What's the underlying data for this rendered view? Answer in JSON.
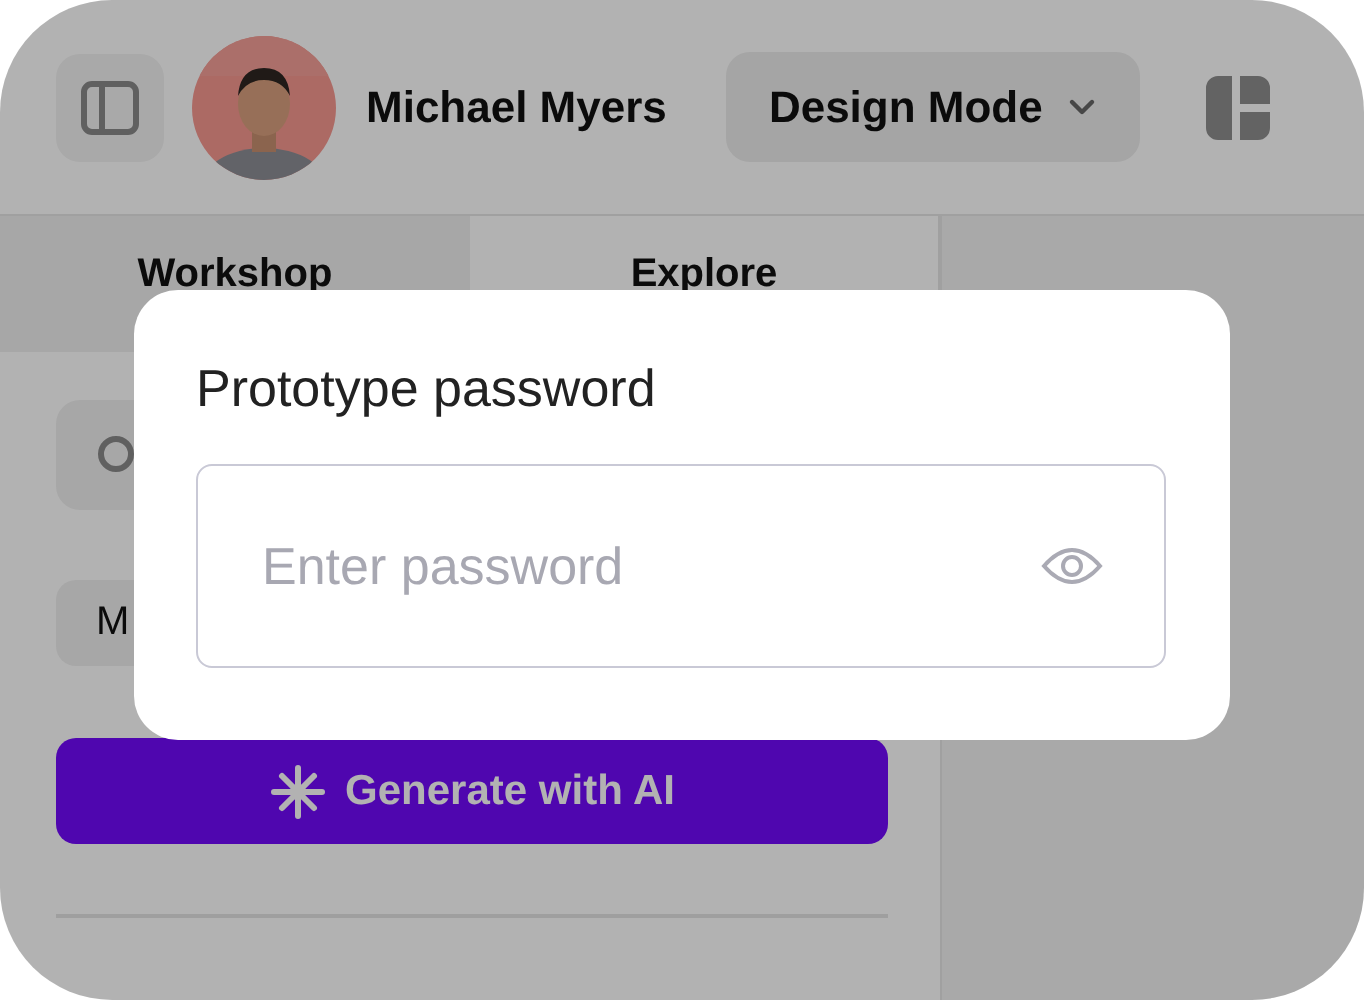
{
  "header": {
    "user_name": "Michael Myers",
    "mode_dropdown": {
      "label": "Design Mode"
    }
  },
  "tabs": [
    {
      "label": "Workshop",
      "selected": false
    },
    {
      "label": "Explore",
      "selected": true
    }
  ],
  "filter_chip": {
    "label": "M"
  },
  "generate_button": {
    "label": "Generate with AI"
  },
  "dialog": {
    "title": "Prototype password",
    "password_field": {
      "placeholder": "Enter password"
    }
  }
}
